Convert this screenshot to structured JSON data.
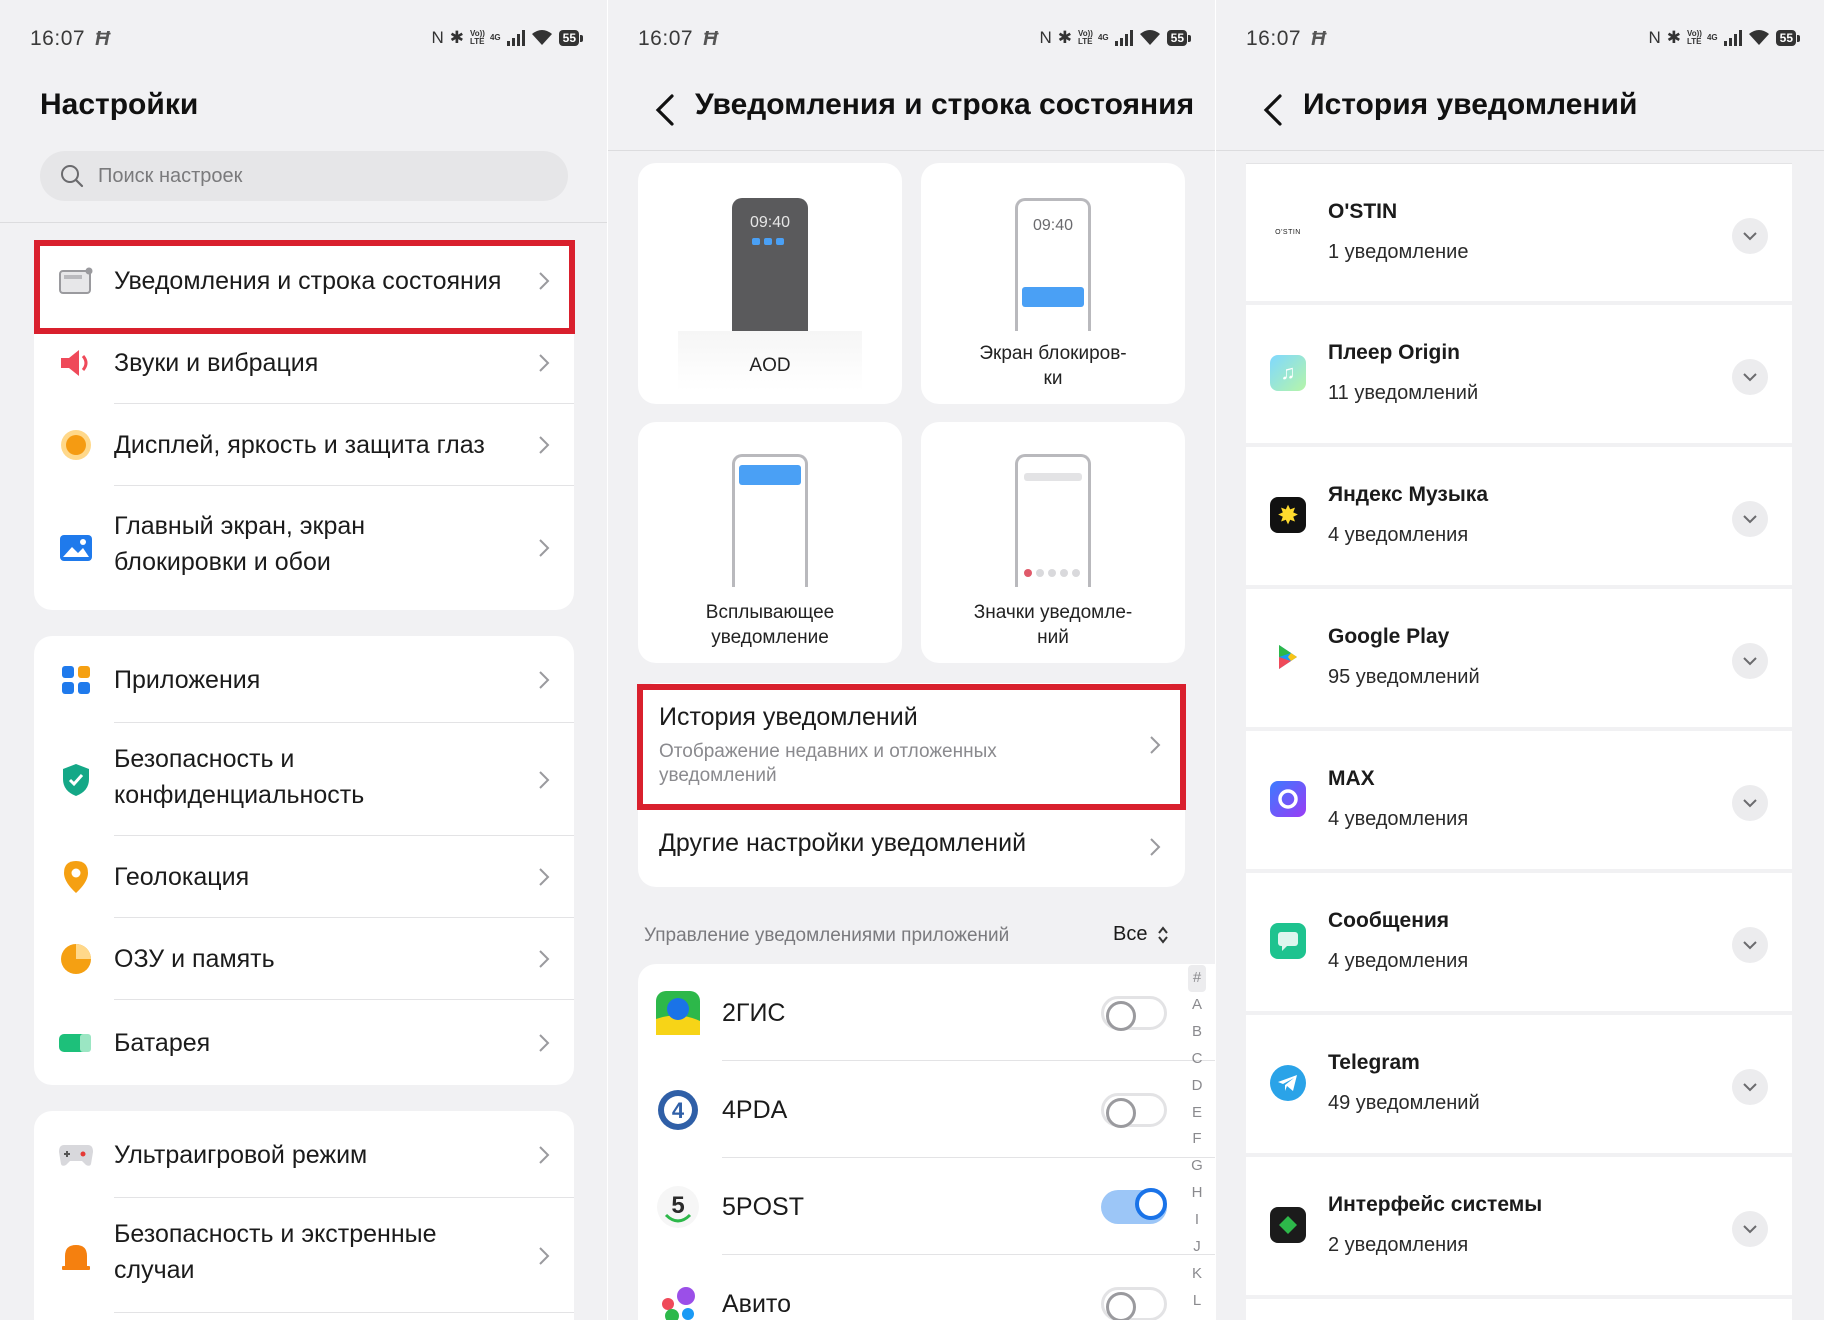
{
  "status_bar": {
    "time": "16:07",
    "battery": "55",
    "volte": "Vo)) LTE",
    "net": "4G"
  },
  "settings": {
    "title": "Настройки",
    "search_placeholder": "Поиск настроек",
    "group1": [
      {
        "label": "Уведомления и строка состояния",
        "icon": "notification-bar-icon"
      },
      {
        "label": "Звуки и вибрация",
        "icon": "speaker-icon"
      },
      {
        "label": "Дисплей, яркость и защита глаз",
        "icon": "display-icon"
      },
      {
        "label": "Главный экран, экран блокировки и обои",
        "line1": "Главный экран, экран",
        "line2": "блокировки и обои",
        "icon": "wallpaper-icon"
      }
    ],
    "group2": [
      {
        "label": "Приложения",
        "icon": "apps-icon"
      },
      {
        "label": "Безопасность и конфиденциальность",
        "line1": "Безопасность и",
        "line2": "конфиденциальность",
        "icon": "shield-icon"
      },
      {
        "label": "Геолокация",
        "icon": "location-icon"
      },
      {
        "label": "ОЗУ и память",
        "icon": "memory-icon"
      },
      {
        "label": "Батарея",
        "icon": "battery-icon"
      }
    ],
    "group3": [
      {
        "label": "Ультраигровой режим",
        "icon": "gamepad-icon"
      },
      {
        "label": "Безопасность и экстренные случаи",
        "line1": "Безопасность и экстренные",
        "line2": "случаи",
        "icon": "emergency-icon"
      }
    ]
  },
  "notifications": {
    "title": "Уведомления и строка состояния",
    "tiles": {
      "aod": {
        "label": "AOD",
        "time": "09:40"
      },
      "lock": {
        "line1": "Экран блокиров-",
        "line2": "ки",
        "time": "09:40"
      },
      "popup": {
        "line1": "Всплывающее",
        "line2": "уведомление"
      },
      "badges": {
        "line1": "Значки уведомле-",
        "line2": "ний"
      }
    },
    "history": {
      "title": "История уведомлений",
      "subtitle_line1": "Отображение недавних и отложенных",
      "subtitle_line2": "уведомлений"
    },
    "other": "Другие настройки уведомлений",
    "manage_label": "Управление уведомлениями приложений",
    "filter": "Все",
    "apps": [
      {
        "name": "2ГИС",
        "enabled": false
      },
      {
        "name": "4PDA",
        "enabled": false
      },
      {
        "name": "5POST",
        "enabled": true
      },
      {
        "name": "Авито",
        "enabled": false
      }
    ],
    "alphabet": [
      "#",
      "A",
      "B",
      "C",
      "D",
      "E",
      "F",
      "G",
      "H",
      "I",
      "J",
      "K",
      "L"
    ]
  },
  "history": {
    "title": "История уведомлений",
    "logo_text": "O'STIN",
    "items": [
      {
        "app": "O'STIN",
        "count": "1 уведомление"
      },
      {
        "app": "Плеер Origin",
        "count": "11 уведомлений"
      },
      {
        "app": "Яндекс Музыка",
        "count": "4 уведомления"
      },
      {
        "app": "Google Play",
        "count": "95 уведомлений"
      },
      {
        "app": "MAX",
        "count": "4 уведомления"
      },
      {
        "app": "Сообщения",
        "count": "4 уведомления"
      },
      {
        "app": "Telegram",
        "count": "49 уведомлений"
      },
      {
        "app": "Интерфейс системы",
        "count": "2 уведомления"
      }
    ]
  },
  "colors": {
    "highlight": "#d9202d",
    "accent": "#1a73e8",
    "background": "#f1f1f3"
  }
}
